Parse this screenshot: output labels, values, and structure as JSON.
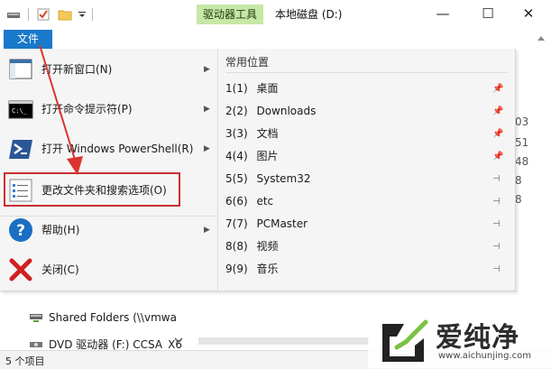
{
  "window": {
    "tool_tab": "驱动器工具",
    "title": "本地磁盘 (D:)",
    "controls": [
      "—",
      "☐",
      "✕"
    ]
  },
  "file_menu": {
    "tab_label": "文件",
    "items": [
      {
        "label": "打开新窗口(N)",
        "icon": "new-window-icon",
        "has_arrow": true
      },
      {
        "label": "打开命令提示符(P)",
        "icon": "command-prompt-icon",
        "has_arrow": true
      },
      {
        "label": "打开 Windows PowerShell(R)",
        "icon": "powershell-icon",
        "has_arrow": true
      },
      {
        "label": "更改文件夹和搜索选项(O)",
        "icon": "folder-options-icon",
        "has_arrow": false
      },
      {
        "label": "帮助(H)",
        "icon": "help-icon",
        "has_arrow": true
      },
      {
        "label": "关闭(C)",
        "icon": "close-red-x-icon",
        "has_arrow": false
      }
    ],
    "recent_header": "常用位置",
    "recent": [
      {
        "num": "1(1)",
        "name": "桌面",
        "pinned": true
      },
      {
        "num": "2(2)",
        "name": "Downloads",
        "pinned": true
      },
      {
        "num": "3(3)",
        "name": "文档",
        "pinned": true
      },
      {
        "num": "4(4)",
        "name": "图片",
        "pinned": true
      },
      {
        "num": "5(5)",
        "name": "System32",
        "pinned": false
      },
      {
        "num": "6(6)",
        "name": "etc",
        "pinned": false
      },
      {
        "num": "7(7)",
        "name": "PCMaster",
        "pinned": false
      },
      {
        "num": "8(8)",
        "name": "视频",
        "pinned": false
      },
      {
        "num": "9(9)",
        "name": "音乐",
        "pinned": false
      }
    ]
  },
  "background": {
    "right_numbers": [
      "03",
      "51",
      "48",
      "8",
      "8"
    ],
    "nav_items": [
      "Shared Folders (\\\\vmwa",
      "DVD 驱动器 (F:) CCSA_X6"
    ],
    "status": "5 个项目"
  },
  "annotation": {
    "highlight_color": "#c8302f"
  },
  "watermark": {
    "text": "爱纯净",
    "url": "www.aichunjing.com"
  }
}
